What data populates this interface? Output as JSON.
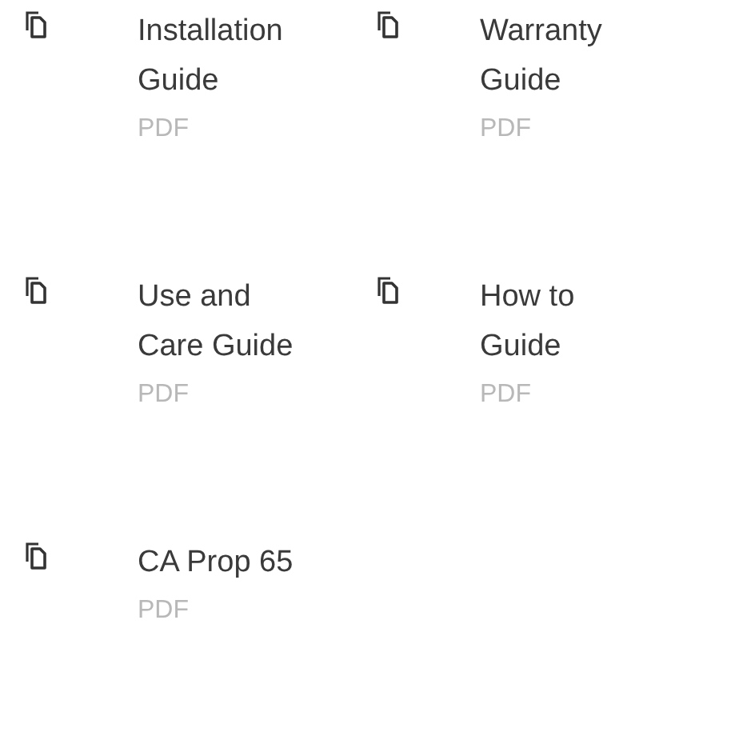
{
  "documents": [
    {
      "title": "Installation Guide",
      "format": "PDF"
    },
    {
      "title": "Warranty Guide",
      "format": "PDF"
    },
    {
      "title": "Use and Care Guide",
      "format": "PDF"
    },
    {
      "title": "How to Guide",
      "format": "PDF"
    },
    {
      "title": "CA Prop 65",
      "format": "PDF"
    }
  ]
}
